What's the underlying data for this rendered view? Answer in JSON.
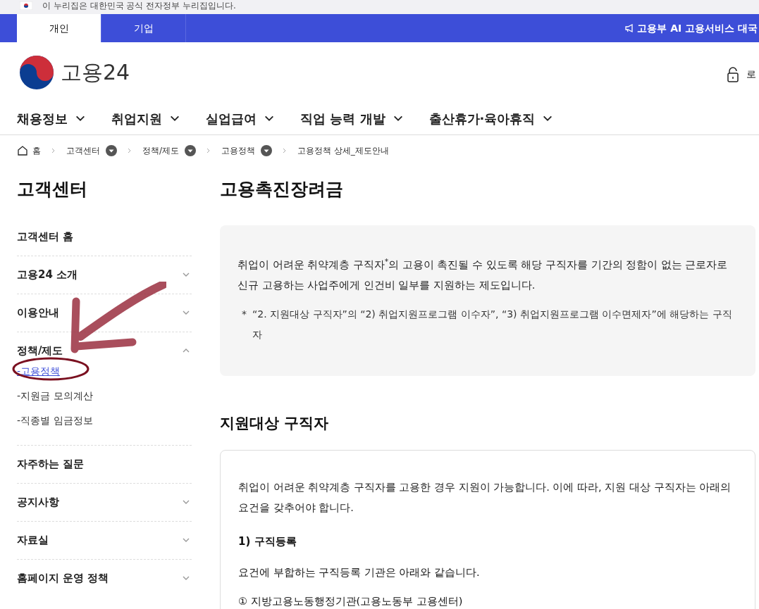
{
  "gov_banner": {
    "text": "이 누리집은 대한민국 공식 전자정부 누리집입니다."
  },
  "user_tabs": [
    {
      "label": "개인",
      "selected": true
    },
    {
      "label": "기업",
      "selected": false
    }
  ],
  "notice": {
    "text": "고용부 AI 고용서비스 대국"
  },
  "header": {
    "logo_text": "고용24",
    "login": "로"
  },
  "main_nav": [
    {
      "label": "채용정보"
    },
    {
      "label": "취업지원"
    },
    {
      "label": "실업급여"
    },
    {
      "label": "직업 능력 개발"
    },
    {
      "label": "출산휴가·육아휴직"
    }
  ],
  "breadcrumb": [
    {
      "label": "홈",
      "kind": "home"
    },
    {
      "label": "고객센터",
      "kind": "dropdown"
    },
    {
      "label": "정책/제도",
      "kind": "dropdown"
    },
    {
      "label": "고용정책",
      "kind": "dropdown"
    },
    {
      "label": "고용정책 상세_제도안내",
      "kind": "plain"
    }
  ],
  "sidebar": {
    "title": "고객센터",
    "items": [
      {
        "label": "고객센터 홈",
        "kind": "link"
      },
      {
        "label": "고용24 소개",
        "kind": "group",
        "expanded": false
      },
      {
        "label": "이용안내",
        "kind": "group",
        "expanded": false
      },
      {
        "label": "정책/제도",
        "kind": "group",
        "expanded": true,
        "children": [
          {
            "label": "-고용정책",
            "selected": true
          },
          {
            "label": "-지원금 모의계산",
            "selected": false
          },
          {
            "label": "-직종별 임금정보",
            "selected": false
          }
        ]
      },
      {
        "label": "자주하는 질문",
        "kind": "link"
      },
      {
        "label": "공지사항",
        "kind": "group",
        "expanded": false
      },
      {
        "label": "자료실",
        "kind": "group",
        "expanded": false
      },
      {
        "label": "홈페이지 운영 정책",
        "kind": "group",
        "expanded": false
      }
    ]
  },
  "content": {
    "title": "고용촉진장려금",
    "summary": {
      "text": "취업이 어려운 취약계층 구직자$^{*}$의 고용이 촉진될 수 있도록 해당 구직자를 기간의 정함이 없는 근로자로 신규 고용하는 사업주에게 인건비 일부를 지원하는 제도입니다.",
      "footnote_mark": "*",
      "footnote": "“2. 지원대상 구직자”의 “2) 취업지원프로그램 이수자”, “3) 취업지원프로그램 이수면제자”에 해당하는 구직자"
    },
    "section_title": "지원대상 구직자",
    "section": {
      "intro": "취업이 어려운 취약계층 구직자를 고용한 경우 지원이 가능합니다. 이에 따라, 지원 대상 구직자는 아래의 요건을 갖추어야 합니다.",
      "subheading": "1) 구직등록",
      "paragraph": "요건에 부합하는 구직등록 기관은 아래와 같습니다.",
      "list_item": "① 지방고용노동행정기관(고용노동부 고용센터)"
    }
  }
}
